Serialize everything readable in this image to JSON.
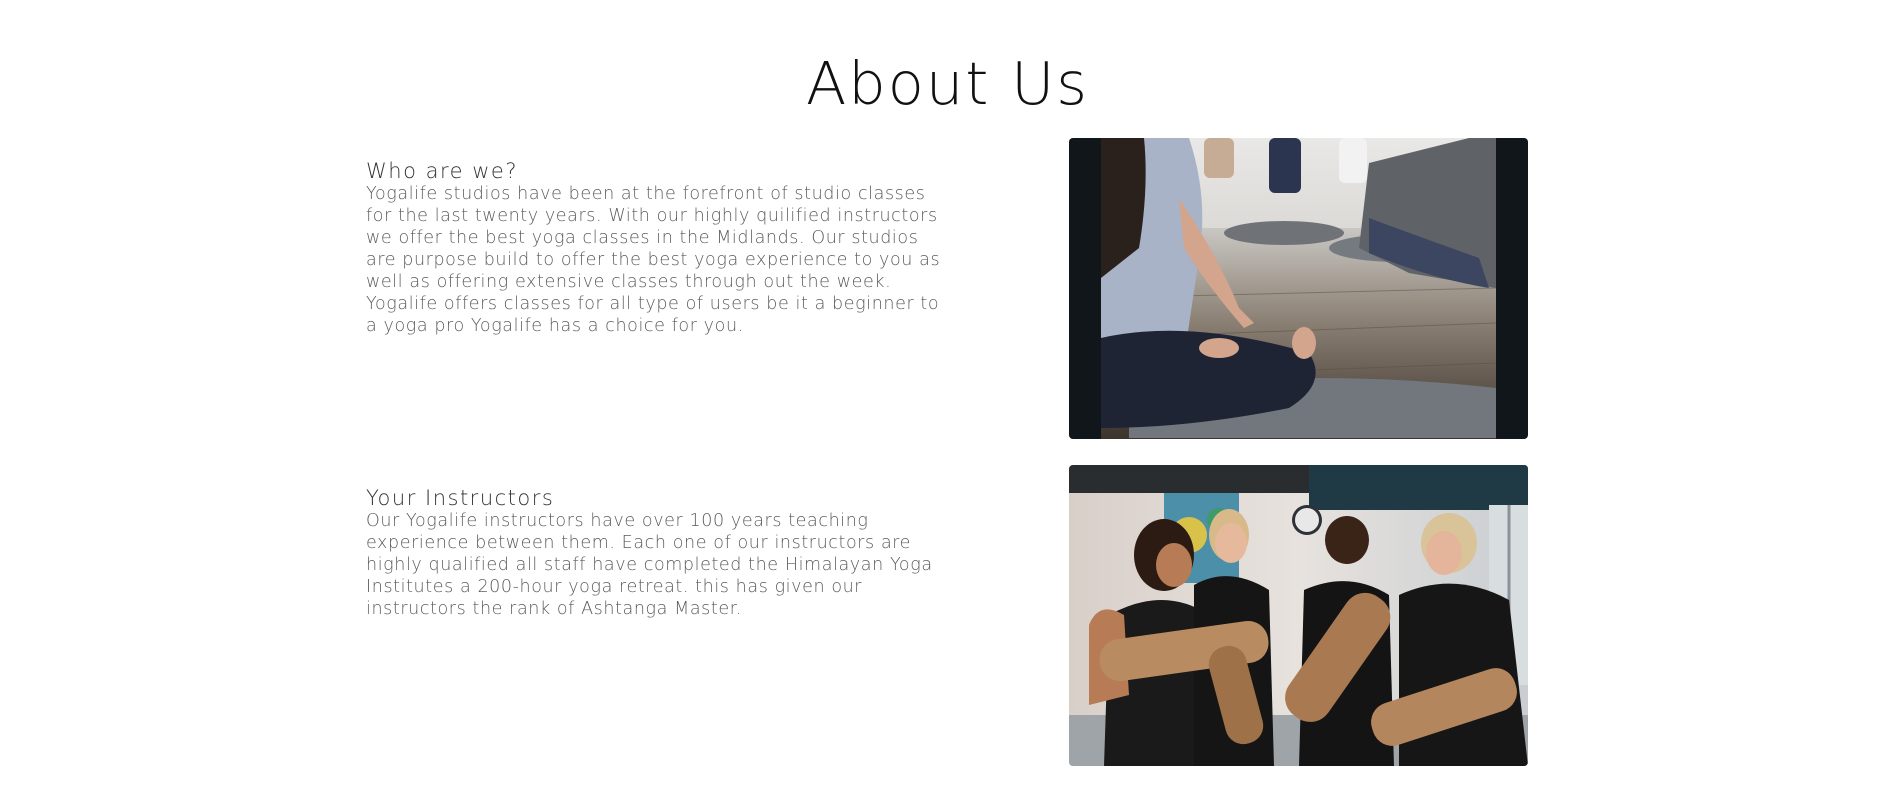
{
  "page": {
    "title": "About Us"
  },
  "sections": [
    {
      "heading": "Who are we?",
      "body": "Yogalife studios have been at the forefront of studio classes for the last twenty years. With our highly quilified instructors we offer the best yoga classes in the Midlands. Our studios are purpose build to offer the best yoga experience to you as well as offering extensive classes through out the week. Yogalife offers classes for all type of users be it a beginner to a yoga pro Yogalife has a choice for you.",
      "image": "yoga-class-seated-meditation-photo"
    },
    {
      "heading": "Your Instructors",
      "body": "Our Yogalife instructors have over 100 years teaching experience between them. Each one of our instructors are highly qualified all staff have completed the Himalayan Yoga Institutes a 200-hour yoga retreat. this has given our instructors the rank of Ashtanga Master.",
      "image": "instructors-group-with-mats-photo"
    }
  ]
}
